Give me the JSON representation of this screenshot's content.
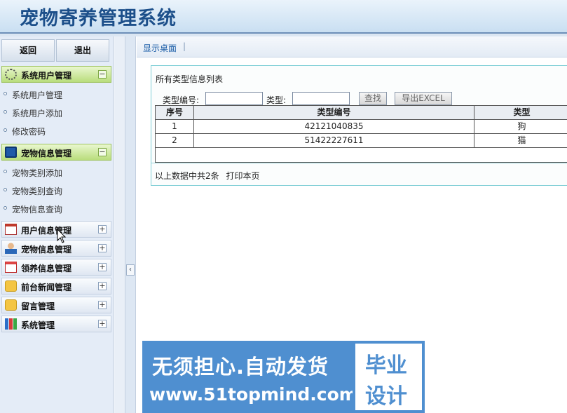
{
  "header": {
    "title": "宠物寄养管理系统"
  },
  "sidebar": {
    "back_label": "返回",
    "exit_label": "退出",
    "groups": [
      {
        "label": "系统用户管理",
        "toggle": "−",
        "icon": "gear-icon",
        "items": [
          {
            "label": "系统用户管理"
          },
          {
            "label": "系统用户添加"
          },
          {
            "label": "修改密码"
          }
        ]
      },
      {
        "label": "宠物信息管理",
        "toggle": "−",
        "icon": "monitor-icon",
        "items": [
          {
            "label": "宠物类别添加"
          },
          {
            "label": "宠物类别查询"
          },
          {
            "label": "宠物信息查询"
          }
        ]
      },
      {
        "label": "用户信息管理",
        "toggle": "+",
        "icon": "calendar-icon"
      },
      {
        "label": "宠物信息管理",
        "toggle": "+",
        "icon": "user-icon"
      },
      {
        "label": "领养信息管理",
        "toggle": "+",
        "icon": "calendar-icon"
      },
      {
        "label": "前台新闻管理",
        "toggle": "+",
        "icon": "news-icon"
      },
      {
        "label": "留言管理",
        "toggle": "+",
        "icon": "message-icon"
      },
      {
        "label": "系统管理",
        "toggle": "+",
        "icon": "chart-icon"
      }
    ]
  },
  "collapse": {
    "glyph": "‹"
  },
  "breadcrumb": {
    "link": "显示桌面",
    "sep": "|"
  },
  "panel": {
    "title": "所有类型信息列表",
    "search": {
      "code_label": "类型编号:",
      "code_value": "",
      "type_label": "类型:",
      "type_value": "",
      "search_button": "查找",
      "export_button": "导出EXCEL"
    },
    "table": {
      "columns": [
        "序号",
        "类型编号",
        "类型"
      ],
      "rows": [
        [
          "1",
          "42121040835",
          "狗"
        ],
        [
          "2",
          "51422227611",
          "猫"
        ]
      ]
    },
    "summary": "以上数据中共2条",
    "print_link": "打印本页"
  },
  "ad": {
    "main_text": "无须担心.自动发货",
    "url": "www.51topmind.com",
    "box_line1": "毕业",
    "box_line2": "设计"
  }
}
